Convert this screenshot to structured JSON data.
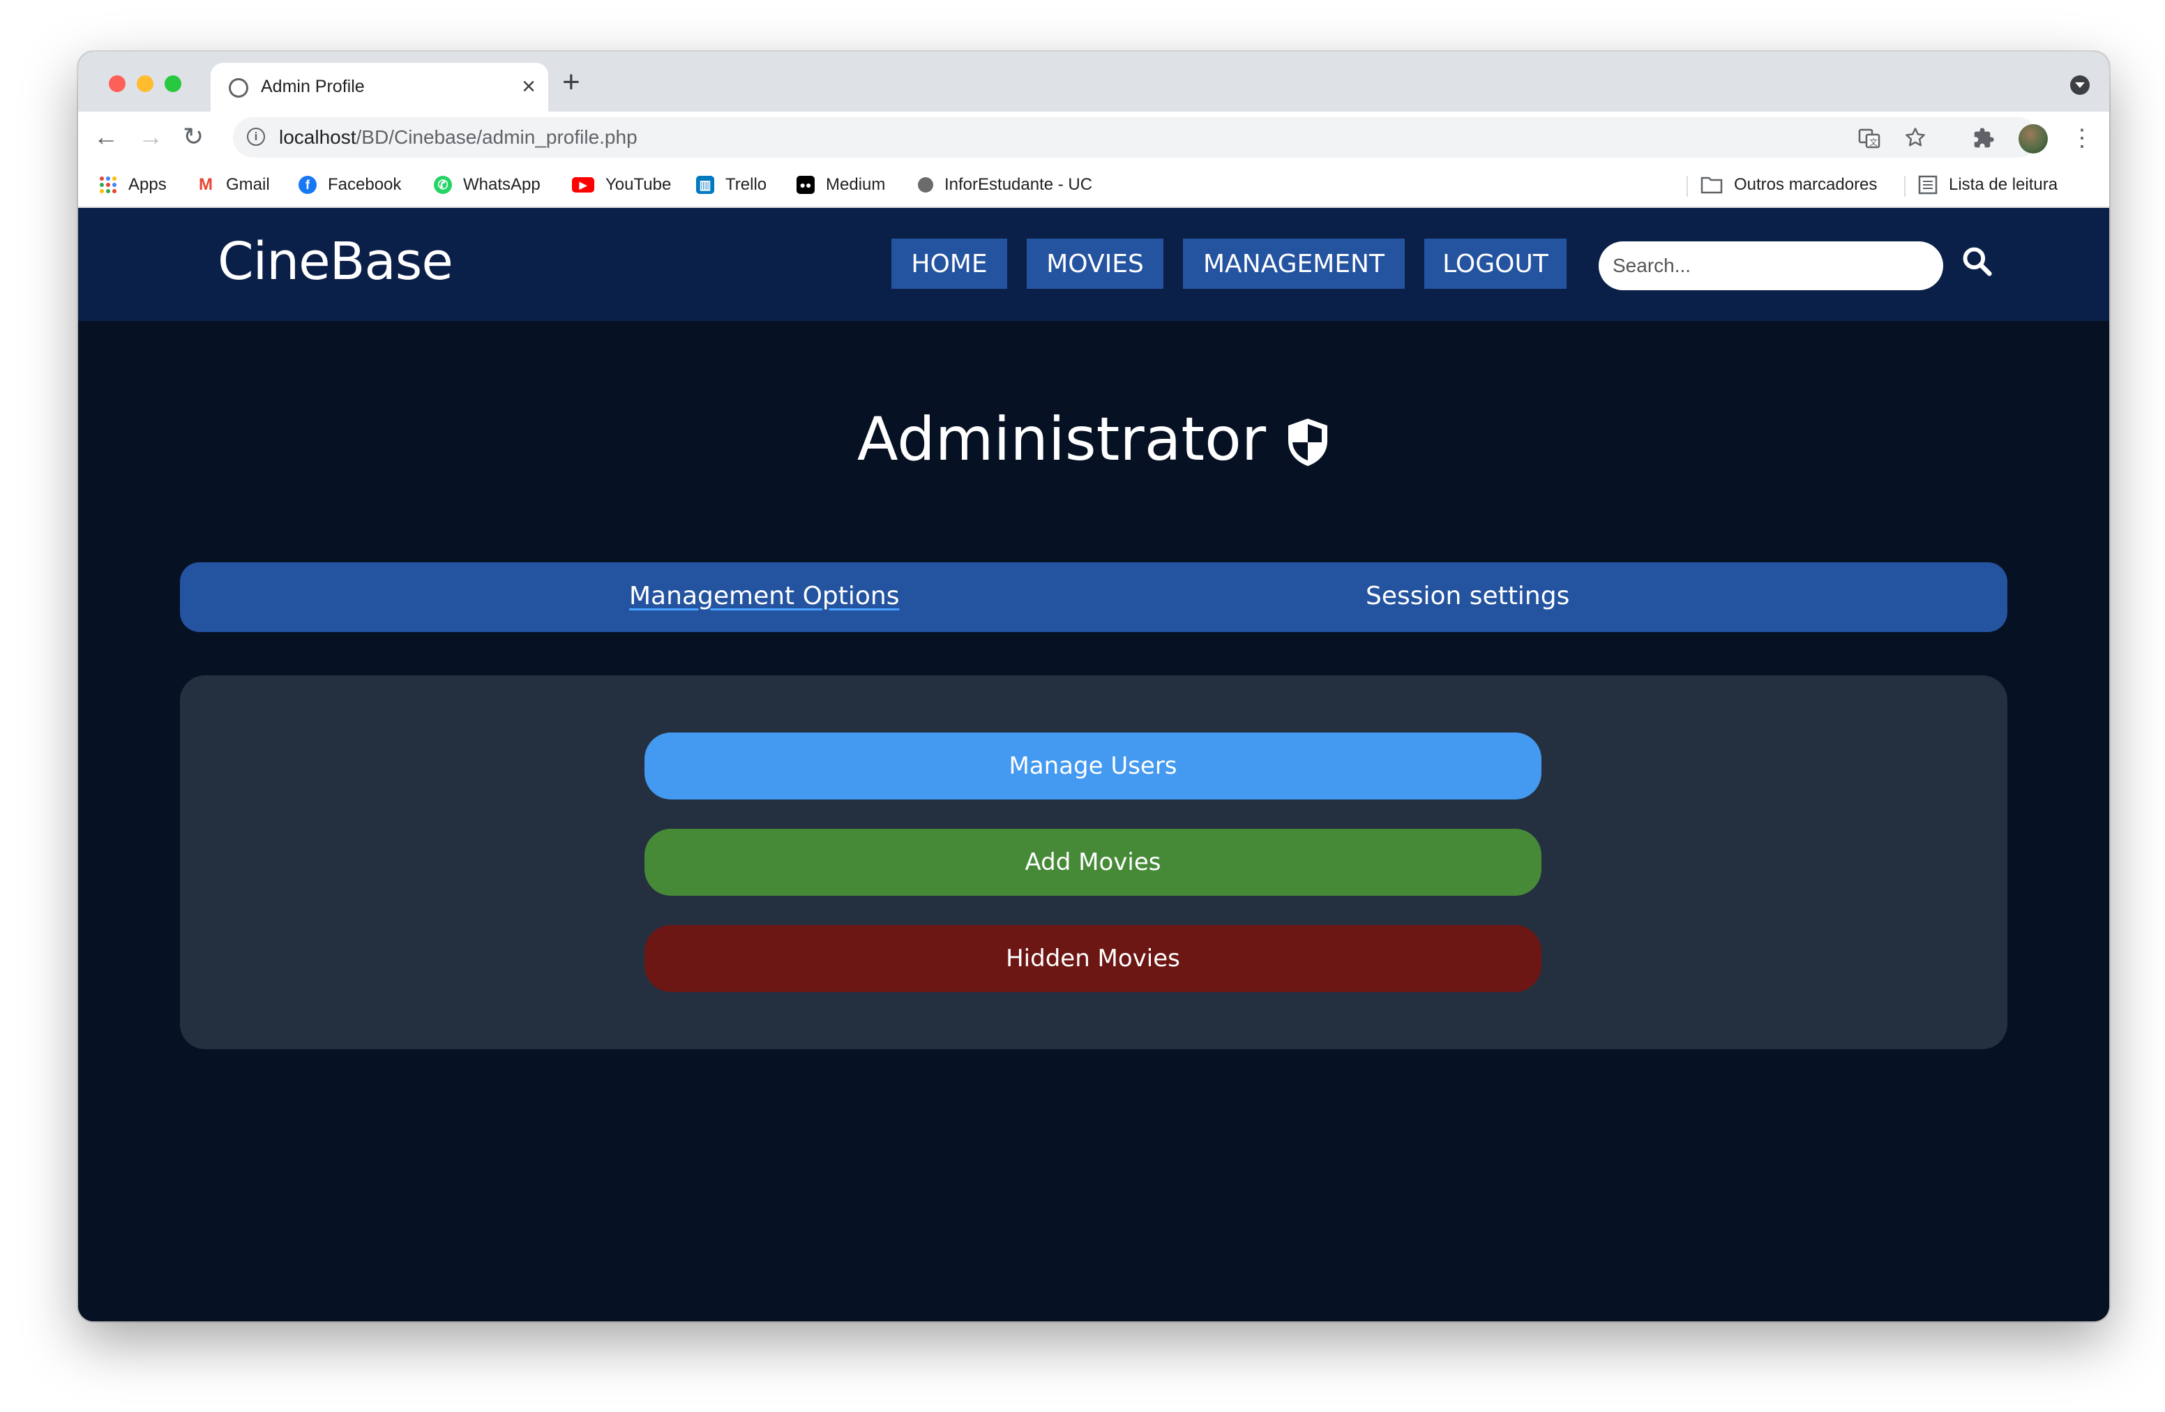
{
  "browser": {
    "tab_title": "Admin Profile",
    "tab_close": "×",
    "new_tab": "+",
    "url_host": "localhost",
    "url_path": "/BD/Cinebase/admin_profile.php",
    "bookmarks": [
      "Apps",
      "Gmail",
      "Facebook",
      "WhatsApp",
      "YouTube",
      "Trello",
      "Medium",
      "InforEstudante - UC"
    ],
    "other_bookmarks": "Outros marcadores",
    "reading_list": "Lista de leitura"
  },
  "site": {
    "logo": "CineBase",
    "nav": [
      "HOME",
      "MOVIES",
      "MANAGEMENT",
      "LOGOUT"
    ],
    "search_placeholder": "Search..."
  },
  "main": {
    "title": "Administrator",
    "tabs": [
      "Management Options",
      "Session settings"
    ],
    "actions": [
      {
        "label": "Manage Users",
        "color": "#4499f0"
      },
      {
        "label": "Add Movies",
        "color": "#468a38"
      },
      {
        "label": "Hidden Movies",
        "color": "#6c1714"
      }
    ]
  }
}
